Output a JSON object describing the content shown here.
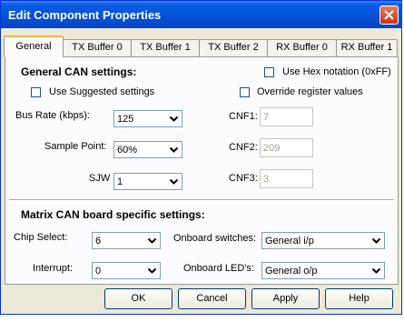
{
  "window": {
    "title": "Edit Component Properties"
  },
  "tabs": [
    {
      "label": "General",
      "active": true
    },
    {
      "label": "TX Buffer 0",
      "active": false
    },
    {
      "label": "TX Buffer 1",
      "active": false
    },
    {
      "label": "TX Buffer 2",
      "active": false
    },
    {
      "label": "RX Buffer 0",
      "active": false
    },
    {
      "label": "RX Buffer 1",
      "active": false
    }
  ],
  "general": {
    "heading": "General CAN settings:",
    "use_hex": {
      "label": "Use Hex notation (0xFF)",
      "checked": false
    },
    "use_suggested": {
      "label": "Use Suggested settings",
      "checked": false
    },
    "override_registers": {
      "label": "Override register values",
      "checked": false
    },
    "bus_rate": {
      "label": "Bus Rate (kbps):",
      "value": "125"
    },
    "sample_point": {
      "label": "Sample Point:",
      "value": "60%"
    },
    "sjw": {
      "label": "SJW",
      "value": "1"
    },
    "cnf1": {
      "label": "CNF1:",
      "value": "7"
    },
    "cnf2": {
      "label": "CNF2:",
      "value": "209"
    },
    "cnf3": {
      "label": "CNF3:",
      "value": "3"
    }
  },
  "matrix": {
    "heading": "Matrix CAN board specific settings:",
    "chip_select": {
      "label": "Chip Select:",
      "value": "6"
    },
    "interrupt": {
      "label": "Interrupt:",
      "value": "0"
    },
    "onboard_switches": {
      "label": "Onboard switches:",
      "value": "General i/p"
    },
    "onboard_leds": {
      "label": "Onboard LED's:",
      "value": "General o/p"
    }
  },
  "buttons": {
    "ok": "OK",
    "cancel": "Cancel",
    "apply": "Apply",
    "help": "Help"
  },
  "icons": {
    "close": "close-icon",
    "dropdown": "chevron-down-icon"
  }
}
